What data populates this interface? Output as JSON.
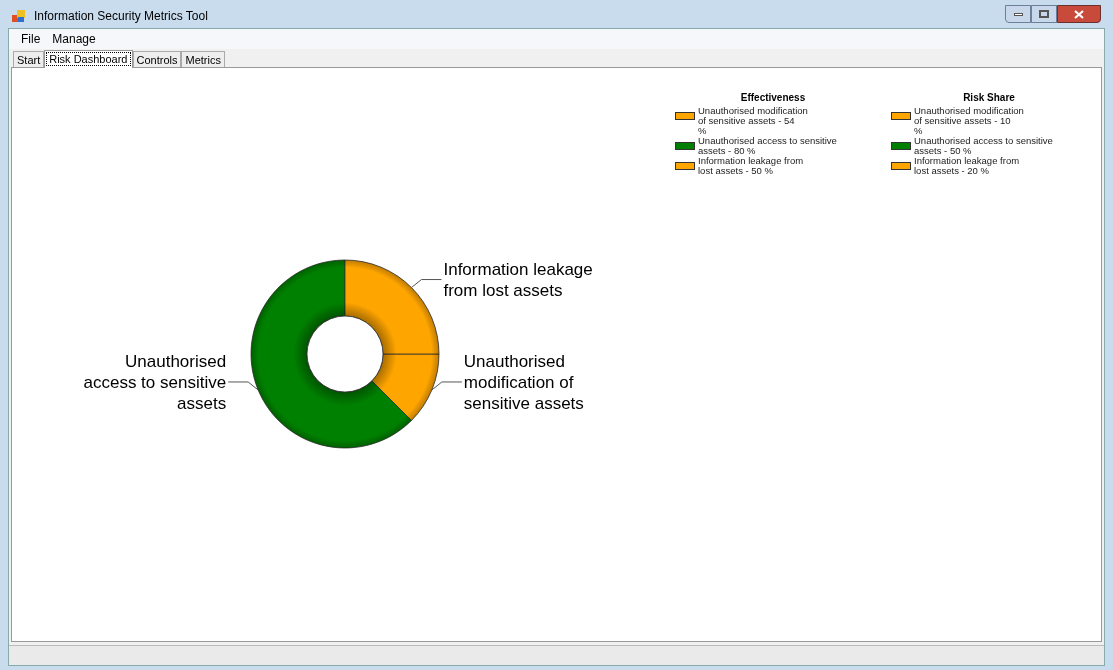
{
  "window": {
    "title": "Information Security Metrics Tool"
  },
  "menu": [
    "File",
    "Manage"
  ],
  "tabs": [
    {
      "label": "Start",
      "selected": false
    },
    {
      "label": "Risk Dashboard",
      "selected": true
    },
    {
      "label": "Controls",
      "selected": false
    },
    {
      "label": "Metrics",
      "selected": false
    }
  ],
  "legends": [
    {
      "title": "Effectiveness",
      "items": [
        {
          "lines": [
            "Unauthorised modification",
            "of sensitive assets - 54",
            "%"
          ],
          "color": "#ffa500"
        },
        {
          "lines": [
            "Unauthorised access to sensitive",
            "assets - 80 %"
          ],
          "color": "#008000"
        },
        {
          "lines": [
            "Information leakage from",
            "lost assets - 50 %"
          ],
          "color": "#ffa500"
        }
      ]
    },
    {
      "title": "Risk Share",
      "items": [
        {
          "lines": [
            "Unauthorised modification",
            "of sensitive assets - 10",
            "%"
          ],
          "color": "#ffa500"
        },
        {
          "lines": [
            "Unauthorised access to sensitive",
            "assets - 50 %"
          ],
          "color": "#008000"
        },
        {
          "lines": [
            "Information leakage from",
            "lost assets - 20 %"
          ],
          "color": "#ffa500"
        }
      ]
    }
  ],
  "chart_data": {
    "type": "donut",
    "categories": [
      "Unauthorised modification of sensitive assets",
      "Unauthorised access to sensitive assets",
      "Information leakage from lost assets"
    ],
    "values": [
      12.5,
      62.5,
      25
    ]
  }
}
